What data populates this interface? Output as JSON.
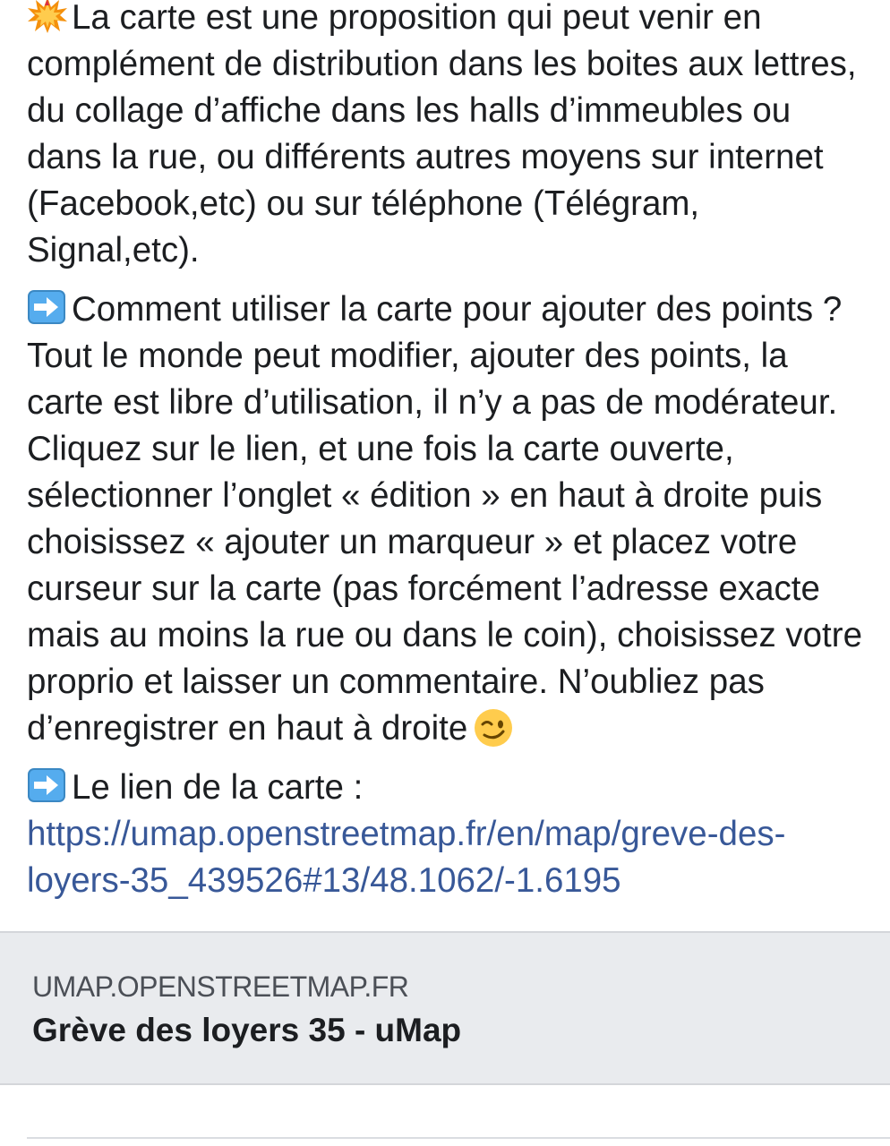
{
  "post": {
    "paragraph1": {
      "icon": "collision-icon",
      "lines": [
        "La carte est une proposition qui peut venir en",
        "complément de distribution dans les boites aux lettres,",
        "du collage d’affiche dans les halls d’immeubles ou",
        "dans la rue, ou différents autres moyens sur internet",
        "(Facebook,etc) ou sur téléphone (Télégram,",
        "Signal,etc)."
      ]
    },
    "paragraph2": {
      "icon": "right-arrow-icon",
      "lines": [
        "Comment utiliser la carte pour ajouter des points ?",
        "Tout le monde peut modifier, ajouter des points, la",
        "carte est libre d’utilisation, il n’y a pas de modérateur.",
        "Cliquez sur le lien, et une fois la carte ouverte,",
        "sélectionner l’onglet « édition » en haut à droite puis",
        "choisissez « ajouter un marqueur » et placez votre",
        "curseur sur la carte (pas forcément l’adresse exacte",
        "mais au moins la rue ou dans le coin), choisissez votre",
        "proprio et laisser un commentaire. N’oubliez pas",
        "d’enregistrer en haut à droite"
      ],
      "trailing_icon": "winking-face-icon"
    },
    "paragraph3": {
      "icon": "right-arrow-icon",
      "label": "Le lien de la carte :",
      "link_lines": [
        "https://umap.openstreetmap.fr/en/map/greve-des-",
        "loyers-35_439526#13/48.1062/-1.6195"
      ]
    }
  },
  "link_preview": {
    "domain": "UMAP.OPENSTREETMAP.FR",
    "title": "Grève des loyers 35 - uMap"
  },
  "colors": {
    "text": "#1c1e21",
    "link": "#385898",
    "preview_background": "#e9ebee",
    "preview_domain": "#4b4f56"
  }
}
